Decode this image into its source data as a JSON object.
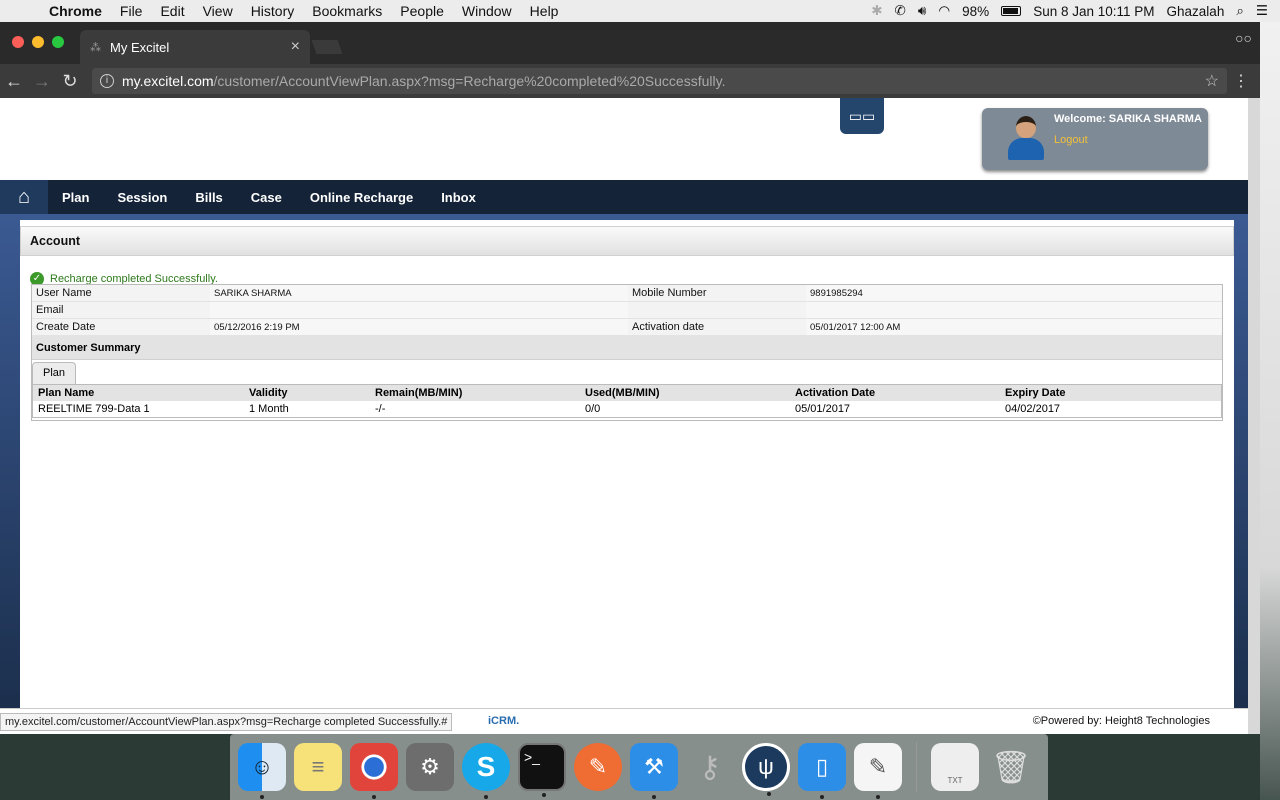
{
  "menubar": {
    "apple": "",
    "items": [
      "Chrome",
      "File",
      "Edit",
      "View",
      "History",
      "Bookmarks",
      "People",
      "Window",
      "Help"
    ],
    "battery": "98%",
    "datetime": "Sun 8 Jan  10:11 PM",
    "user": "Ghazalah"
  },
  "browser": {
    "tab_title": "My Excitel",
    "url_host": "my.excitel.com",
    "url_path": "/customer/AccountViewPlan.aspx?msg=Recharge%20completed%20Successfully."
  },
  "header": {
    "welcome": "Welcome: SARIKA SHARMA",
    "logout": "Logout"
  },
  "nav": {
    "items": [
      "Plan",
      "Session",
      "Bills",
      "Case",
      "Online Recharge",
      "Inbox"
    ]
  },
  "account": {
    "title": "Account",
    "message": "Recharge completed Successfully.",
    "fields": {
      "user_name_label": "User Name",
      "user_name": "SARIKA SHARMA",
      "mobile_label": "Mobile Number",
      "mobile": "9891985294",
      "email_label": "Email",
      "email": "",
      "create_date_label": "Create Date",
      "create_date": "05/12/2016 2:19 PM",
      "activation_label": "Activation date",
      "activation": "05/01/2017 12:00 AM"
    },
    "customer_summary": "Customer Summary",
    "plan_tab": "Plan",
    "table": {
      "headers": [
        "Plan Name",
        "Validity",
        "Remain(MB/MIN)",
        "Used(MB/MIN)",
        "Activation Date",
        "Expiry Date"
      ],
      "rows": [
        [
          "REELTIME 799-Data 1",
          "1 Month",
          "-/-",
          "0/0",
          "05/01/2017",
          "04/02/2017"
        ]
      ]
    }
  },
  "footer": {
    "status_url": "my.excitel.com/customer/AccountViewPlan.aspx?msg=Recharge completed Successfully.#",
    "icrm": "iCRM.",
    "powered": "©Powered by: Height8 Technologies"
  },
  "dock": {
    "icons": [
      "finder-icon",
      "notes-icon",
      "chrome-icon",
      "system-preferences-icon",
      "skype-icon",
      "terminal-icon",
      "postman-icon",
      "xcode-icon",
      "keychain-icon",
      "sourcetree-icon",
      "simulator-icon",
      "textedit-icon",
      "txt-file-icon",
      "trash-icon"
    ],
    "txt_label": "TXT"
  }
}
